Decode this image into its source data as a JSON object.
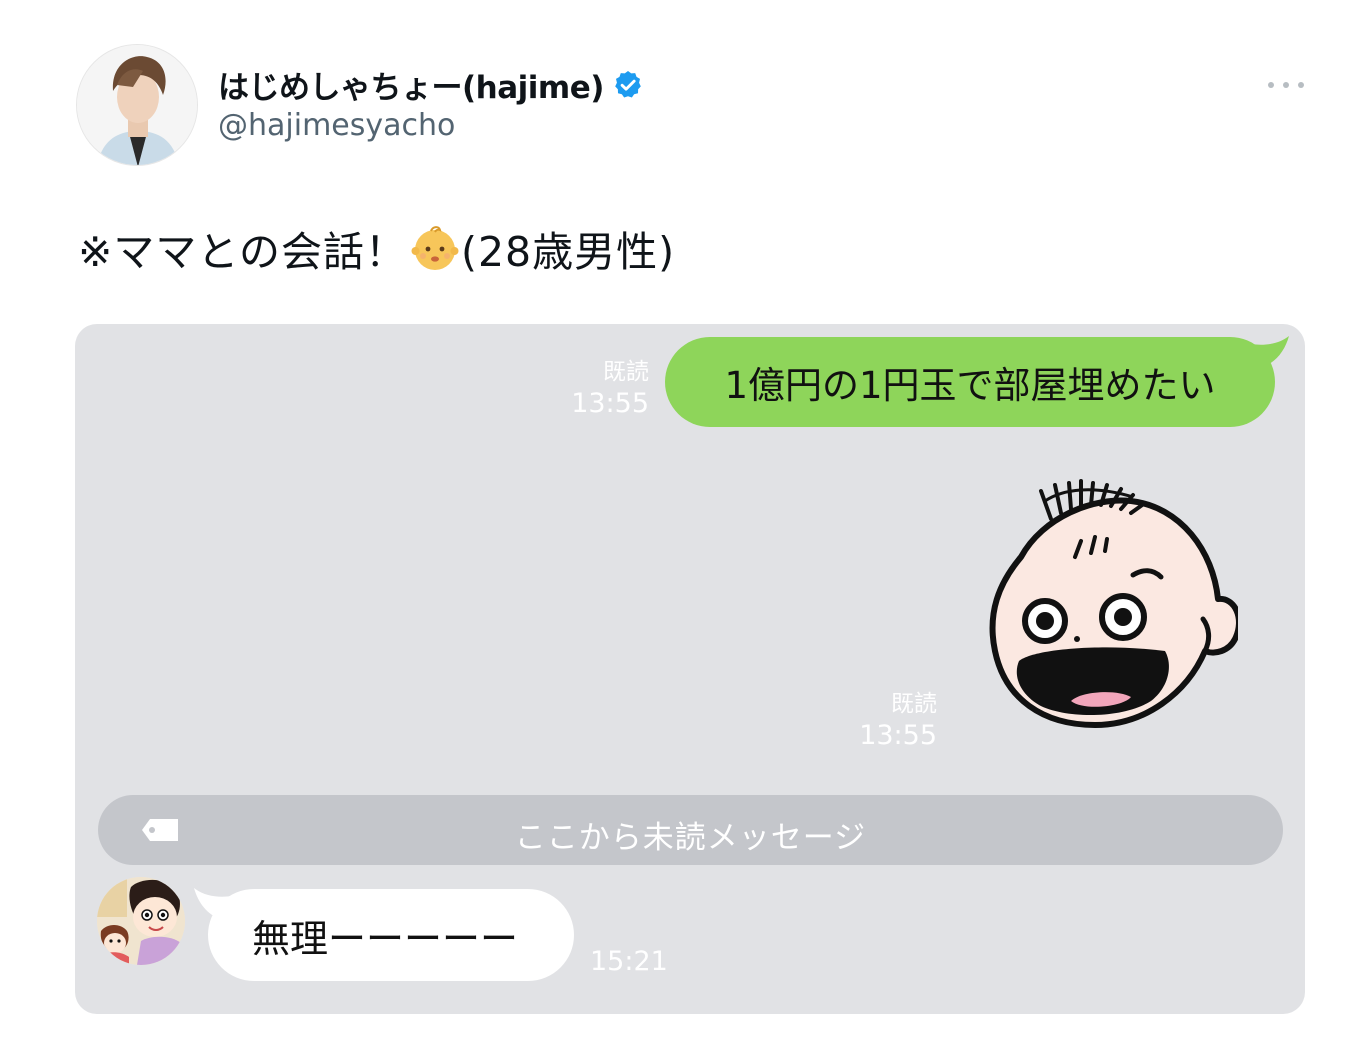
{
  "tweet": {
    "author_name": "はじめしゃちょー(hajime)",
    "author_handle": "@hajimesyacho",
    "verified_icon": "verified-badge-icon",
    "more_icon": "more-options-icon",
    "text_before_emoji": "※ママとの会話！",
    "emoji": "baby-emoji",
    "text_after_emoji": "(28歳男性)"
  },
  "chat": {
    "messages": [
      {
        "direction": "outgoing",
        "text": "1億円の1円玉で部屋埋めたい",
        "read_label": "既読",
        "time": "13:55"
      },
      {
        "direction": "outgoing",
        "sticker": "baby-face-sticker",
        "read_label": "既読",
        "time": "13:55"
      }
    ],
    "unread_divider": "ここから未読メッセージ",
    "reply": {
      "direction": "incoming",
      "text": "無理ーーーーー",
      "time": "15:21"
    }
  },
  "colors": {
    "chat_background": "#e1e2e5",
    "outgoing_bubble": "#8ed55a",
    "incoming_bubble": "#ffffff",
    "divider": "#c4c6cb",
    "verified": "#1d9bf0"
  }
}
